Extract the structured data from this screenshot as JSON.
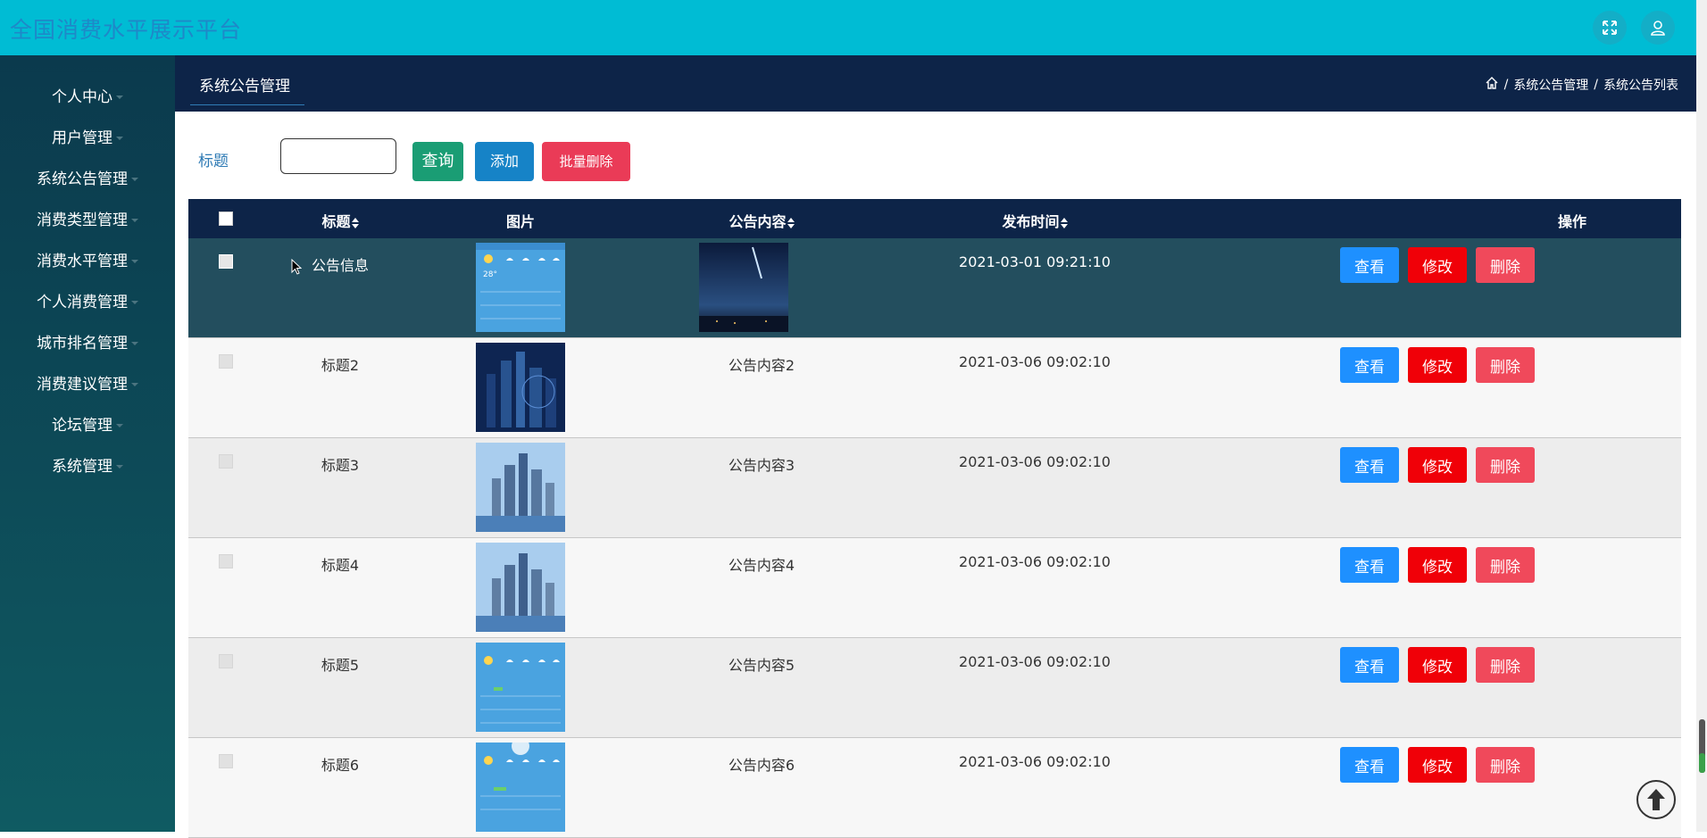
{
  "header": {
    "app_title": "全国消费水平展示平台",
    "fullscreen_icon": "expand-icon",
    "user_icon": "user-icon"
  },
  "sidebar": {
    "items": [
      {
        "label": "个人中心"
      },
      {
        "label": "用户管理"
      },
      {
        "label": "系统公告管理"
      },
      {
        "label": "消费类型管理"
      },
      {
        "label": "消费水平管理"
      },
      {
        "label": "个人消费管理"
      },
      {
        "label": "城市排名管理"
      },
      {
        "label": "消费建议管理"
      },
      {
        "label": "论坛管理"
      },
      {
        "label": "系统管理"
      }
    ]
  },
  "breadcrumb": {
    "tab": "系统公告管理",
    "home_icon": "home-icon",
    "path": [
      "系统公告管理",
      "系统公告列表"
    ],
    "separator": "/"
  },
  "search": {
    "label": "标题",
    "value": "",
    "placeholder": "",
    "query_label": "查询",
    "add_label": "添加",
    "bulk_delete_label": "批量删除"
  },
  "table": {
    "headers": {
      "title": "标题",
      "image": "图片",
      "content": "公告内容",
      "time": "发布时间",
      "ops": "操作"
    },
    "ops": {
      "view": "查看",
      "edit": "修改",
      "delete": "删除"
    },
    "rows": [
      {
        "title": "公告信息",
        "content": "",
        "time": "2021-03-01 09:21:10",
        "image": "weather-forecast",
        "content_image": "night-sky"
      },
      {
        "title": "标题2",
        "content": "公告内容2",
        "time": "2021-03-06 09:02:10",
        "image": "night-city"
      },
      {
        "title": "标题3",
        "content": "公告内容3",
        "time": "2021-03-06 09:02:10",
        "image": "city-skyline"
      },
      {
        "title": "标题4",
        "content": "公告内容4",
        "time": "2021-03-06 09:02:10",
        "image": "city-skyline"
      },
      {
        "title": "标题5",
        "content": "公告内容5",
        "time": "2021-03-06 09:02:10",
        "image": "weather-forecast"
      },
      {
        "title": "标题6",
        "content": "公告内容6",
        "time": "2021-03-06 09:02:10",
        "image": "weather-forecast-sun"
      }
    ]
  },
  "colors": {
    "topbar": "#00bcd4",
    "sidebar": "#0d4b58",
    "crumbbar": "#0d2448",
    "selected_row": "#234e5e",
    "view_button": "#1e90ff",
    "edit_button": "#f00008",
    "delete_button": "#f0495b"
  },
  "back_to_top_icon": "arrow-up-icon"
}
